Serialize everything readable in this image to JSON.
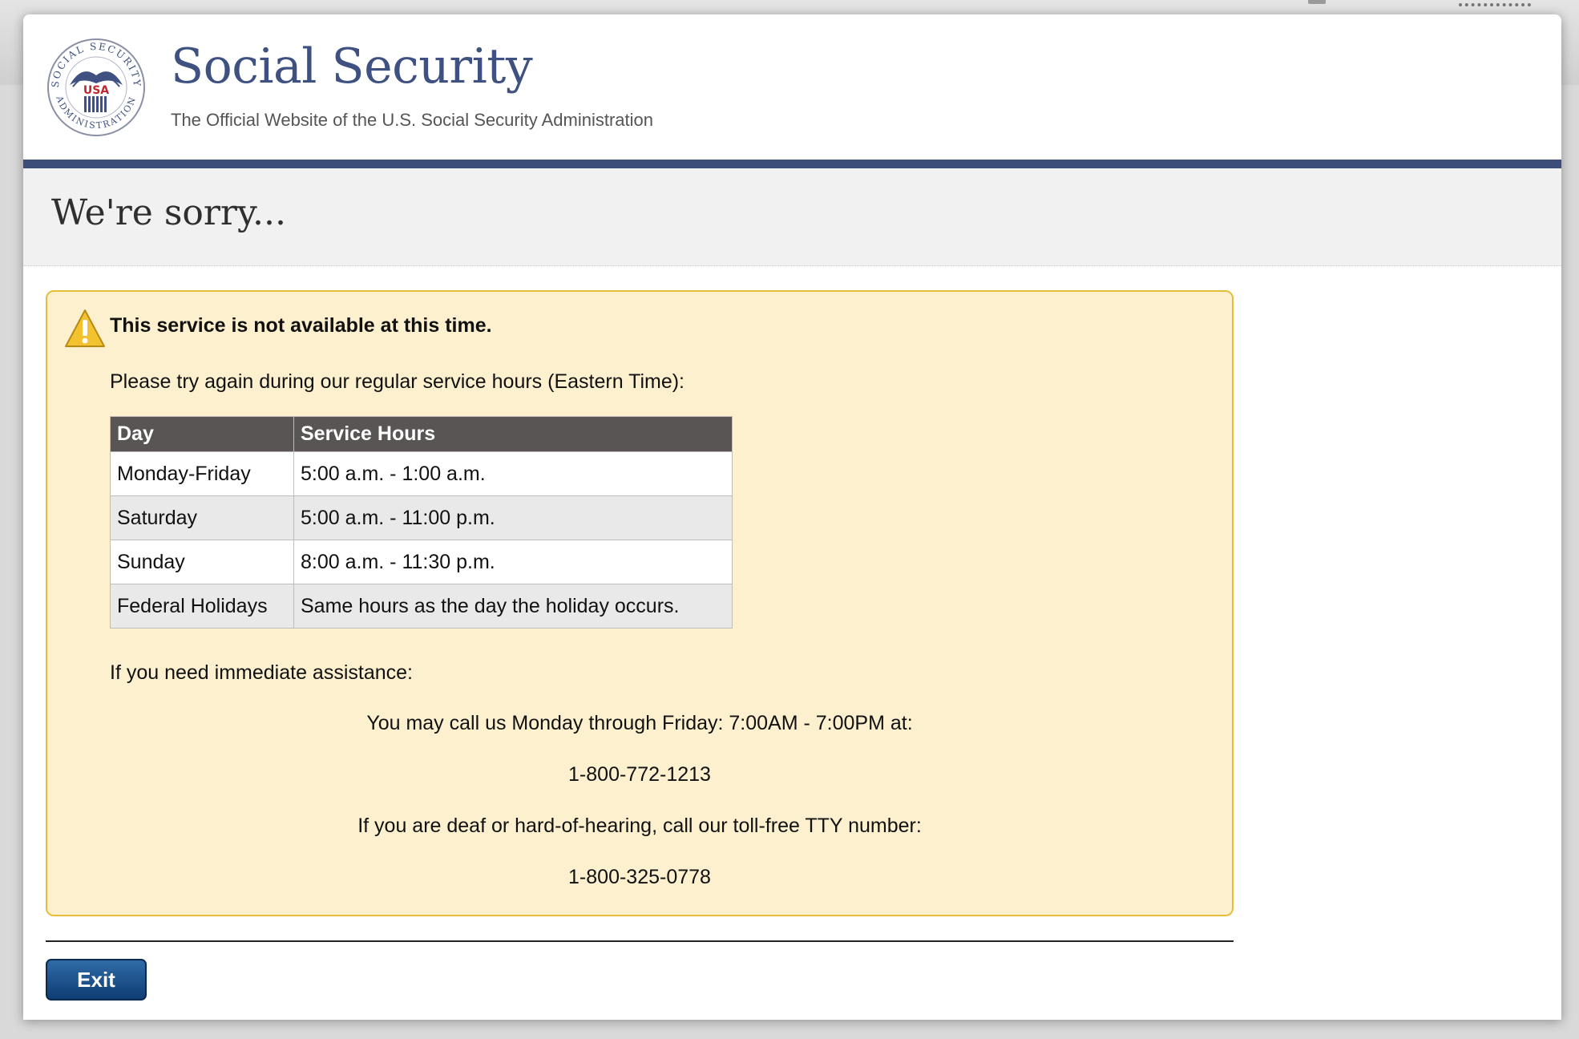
{
  "header": {
    "site_title": "Social Security",
    "site_subtitle": "The Official Website of the U.S. Social Security Administration",
    "seal_text": "SOCIAL SECURITY ADMINISTRATION USA",
    "brand_color": "#3d4d7a"
  },
  "page": {
    "title": "We're sorry..."
  },
  "alert": {
    "icon": "warning-icon",
    "heading": "This service is not available at this time.",
    "intro": "Please try again during our regular service hours (Eastern Time):",
    "table": {
      "headers": [
        "Day",
        "Service Hours"
      ],
      "rows": [
        [
          "Monday-Friday",
          "5:00 a.m. - 1:00 a.m."
        ],
        [
          "Saturday",
          "5:00 a.m. - 11:00 p.m."
        ],
        [
          "Sunday",
          "8:00 a.m. - 11:30 p.m."
        ],
        [
          "Federal Holidays",
          "Same hours as the day the holiday occurs."
        ]
      ]
    },
    "assist_label": "If you need immediate assistance:",
    "call_text": "You may call us Monday through Friday: 7:00AM - 7:00PM at:",
    "phone": "1-800-772-1213",
    "tty_text": "If you are deaf or hard-of-hearing, call our toll-free TTY number:",
    "tty_phone": "1-800-325-0778",
    "background_color": "#fcf0cf",
    "border_color": "#e6bf3a"
  },
  "footer": {
    "exit_label": "Exit"
  }
}
